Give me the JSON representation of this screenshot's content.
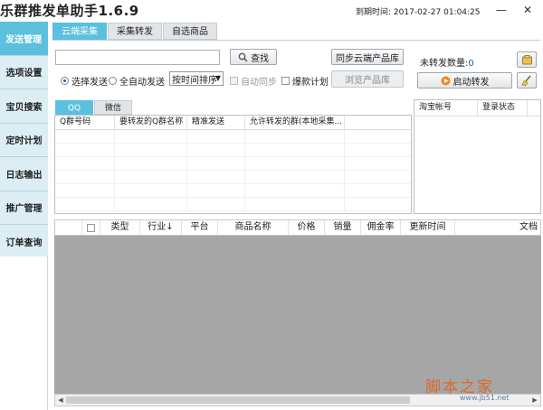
{
  "app": {
    "title": "乐群推发单助手1.6.9",
    "expire_label": "到期时间:",
    "expire_value": "2017-02-27 01:04:25",
    "minimize": "—",
    "close": "✕"
  },
  "sidebar": {
    "items": [
      {
        "label": "发送管理"
      },
      {
        "label": "选项设置"
      },
      {
        "label": "宝贝搜索"
      },
      {
        "label": "定时计划"
      },
      {
        "label": "日志输出"
      },
      {
        "label": "推广管理"
      },
      {
        "label": "订单查询"
      }
    ]
  },
  "tabs": [
    {
      "label": "云端采集"
    },
    {
      "label": "采集转发"
    },
    {
      "label": "自选商品"
    }
  ],
  "search": {
    "value": "",
    "button": "查找"
  },
  "send_mode": {
    "option1": "选择发送",
    "option2": "全自动发送",
    "sort_value": "按时间排序"
  },
  "sync": {
    "button": "同步云端产品库",
    "auto_sync": "自动同步",
    "hot_plan": "爆款计划",
    "browse": "浏览产品库"
  },
  "right": {
    "pending_label": "未转发数量:",
    "pending_value": "0",
    "start_button": "启动转发"
  },
  "subtabs": [
    {
      "label": "QQ"
    },
    {
      "label": "微信"
    }
  ],
  "qq_table": {
    "columns": [
      "Q群号码",
      "要转发的Q群名称",
      "精准发送",
      "允许转发的群(本地采集..."
    ]
  },
  "taobao_table": {
    "columns": [
      "淘宝帐号",
      "登录状态"
    ]
  },
  "product_table": {
    "columns": [
      "",
      "类型",
      "行业↓",
      "平台",
      "商品名称",
      "价格",
      "销量",
      "佣金率",
      "更新时间",
      "文档"
    ]
  },
  "watermark": {
    "text": "脚本之家",
    "url": "www.jb51.net"
  },
  "colors": {
    "accent": "#5bc0de",
    "sidebar_bg": "#dceef4",
    "table_body": "#a6a6a6"
  }
}
